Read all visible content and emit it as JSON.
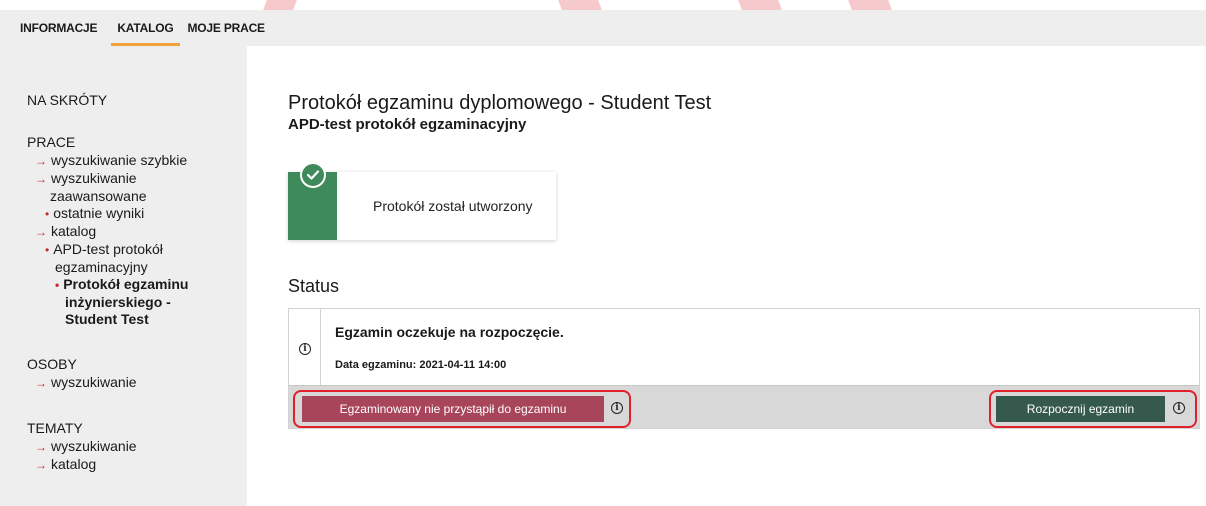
{
  "topnav": {
    "tabs": [
      {
        "label": "INFORMACJE"
      },
      {
        "label": "KATALOG",
        "active": true
      },
      {
        "label": "MOJE PRACE"
      }
    ]
  },
  "sidebar": {
    "shortcuts_title": "NA SKRÓTY",
    "prace": {
      "title": "PRACE",
      "quick_search": "wyszukiwanie szybkie",
      "advanced_search_line1": "wyszukiwanie",
      "advanced_search_line2": "zaawansowane",
      "recent_results": "ostatnie wyniki",
      "catalog": "katalog",
      "apd_line1": "APD-test protokół",
      "apd_line2": "egzaminacyjny",
      "protocol_line1": "Protokół egzaminu",
      "protocol_line2": "inżynierskiego -",
      "protocol_line3": "Student Test"
    },
    "osoby": {
      "title": "OSOBY",
      "search": "wyszukiwanie"
    },
    "tematy": {
      "title": "TEMATY",
      "search": "wyszukiwanie",
      "catalog": "katalog"
    }
  },
  "main": {
    "title": "Protokół egzaminu dyplomowego - Student Test",
    "subtitle": "APD-test protokół egzaminacyjny",
    "created_card_text": "Protokół został utworzony",
    "status_heading": "Status",
    "status_message": "Egzamin oczekuje na rozpoczęcie.",
    "exam_date": "Data egzaminu: 2021-04-11 14:00",
    "absent_button": "Egzaminowany nie przystąpił do egzaminu",
    "start_button": "Rozpocznij egzamin"
  },
  "colors": {
    "accent_tab": "#f0a23b",
    "arrow": "#c8292f",
    "success_green": "#3e8a5b",
    "absent_button": "#a8455b",
    "start_button": "#355a4d",
    "highlight": "#e0202a"
  }
}
